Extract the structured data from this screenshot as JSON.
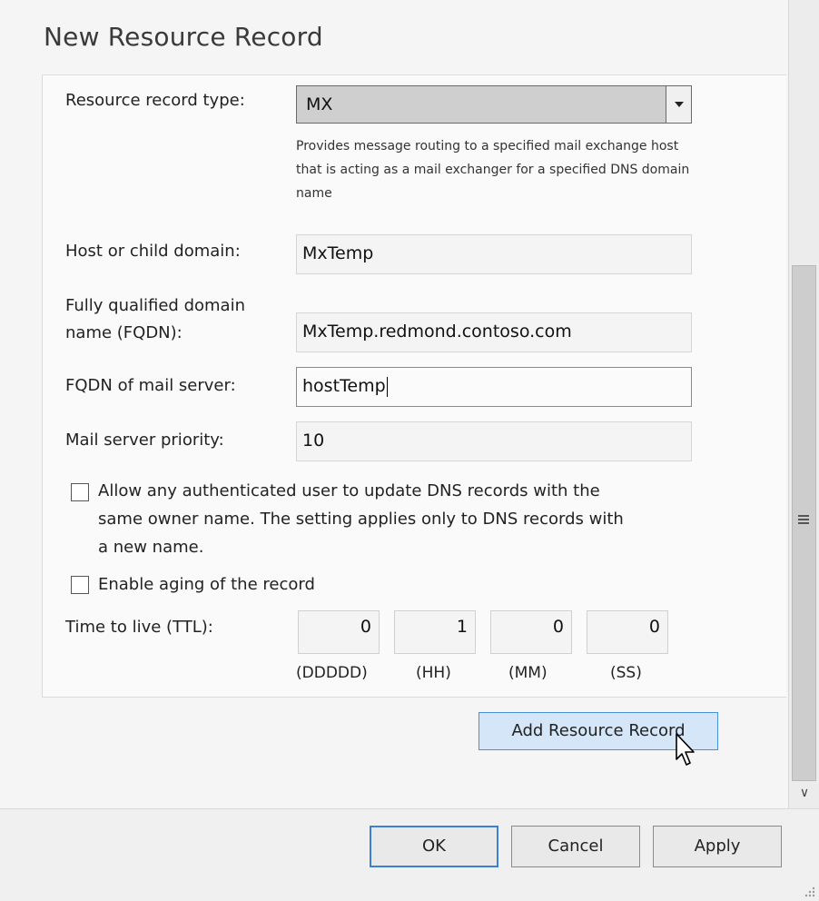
{
  "dialog": {
    "title": "New Resource Record"
  },
  "record_type": {
    "label": "Resource record type:",
    "value": "MX",
    "description": "Provides message routing to a specified mail exchange host that is acting as a mail exchanger for a specified DNS domain name"
  },
  "host": {
    "label": "Host or child domain:",
    "value": "MxTemp"
  },
  "fqdn": {
    "label_line1": "Fully qualified domain",
    "label_line2": "name (FQDN):",
    "value": "MxTemp.redmond.contoso.com"
  },
  "mail_server_fqdn": {
    "label": "FQDN of mail server:",
    "value": "hostTemp"
  },
  "priority": {
    "label": "Mail server priority:",
    "value": "10"
  },
  "allow_update": {
    "checked": false,
    "line1": "Allow any authenticated user to update DNS records with the",
    "line2": "same owner name. The setting applies only to DNS records with",
    "line3": "a new name."
  },
  "aging": {
    "checked": false,
    "label": "Enable aging of the record"
  },
  "ttl": {
    "label": "Time to live (TTL):",
    "days": "0",
    "hours": "1",
    "minutes": "0",
    "seconds": "0",
    "days_unit": "(DDDDD)",
    "hours_unit": "(HH)",
    "minutes_unit": "(MM)",
    "seconds_unit": "(SS)"
  },
  "buttons": {
    "add": "Add Resource Record",
    "ok": "OK",
    "cancel": "Cancel",
    "apply": "Apply"
  },
  "colors": {
    "accent": "#3c7fd6",
    "add_button_bg": "#d4e6f7"
  },
  "icons": {
    "dropdown": "chevron-down-icon",
    "cursor": "mouse-pointer-icon",
    "scroll_grip": "grip-icon",
    "scroll_down": "scroll-down-icon",
    "resize": "resize-grip-icon"
  }
}
